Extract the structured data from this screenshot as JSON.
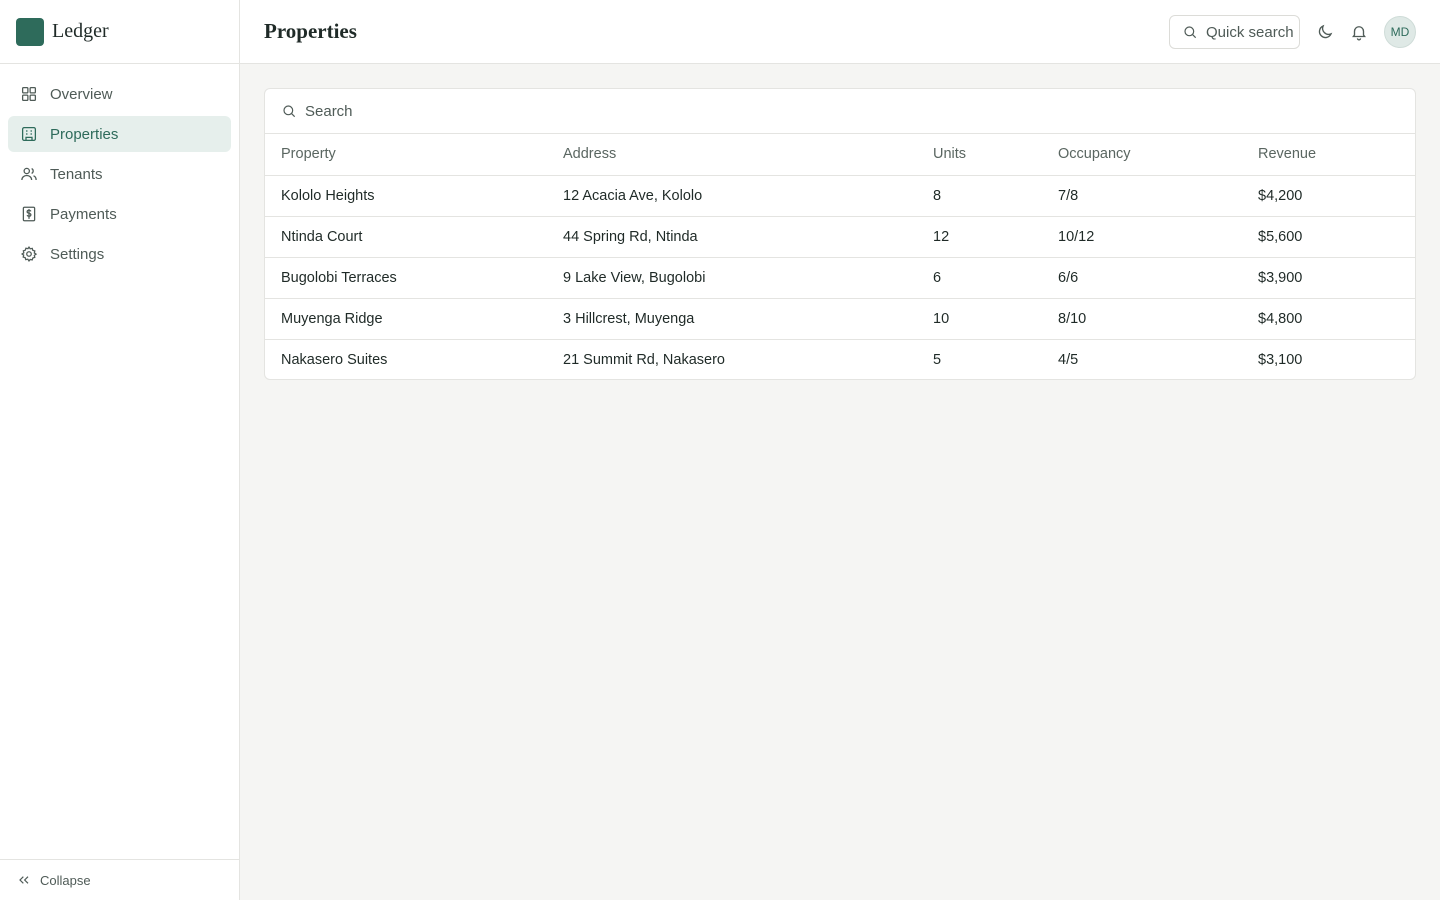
{
  "app": {
    "name": "Ledger",
    "brand_color": "#2e6b5b"
  },
  "sidebar": {
    "items": [
      {
        "label": "Overview",
        "icon": "grid-icon"
      },
      {
        "label": "Properties",
        "icon": "building-icon",
        "active": true
      },
      {
        "label": "Tenants",
        "icon": "users-icon"
      },
      {
        "label": "Payments",
        "icon": "receipt-dollar-icon"
      },
      {
        "label": "Settings",
        "icon": "gear-icon"
      }
    ],
    "collapse_label": "Collapse"
  },
  "header": {
    "title": "Properties",
    "quick_search_label": "Quick search",
    "avatar_initials": "MD"
  },
  "table": {
    "search_placeholder": "Search",
    "columns": [
      "Property",
      "Address",
      "Units",
      "Occupancy",
      "Revenue"
    ],
    "rows": [
      [
        "Kololo Heights",
        "12 Acacia Ave, Kololo",
        "8",
        "7/8",
        "$4,200"
      ],
      [
        "Ntinda Court",
        "44 Spring Rd, Ntinda",
        "12",
        "10/12",
        "$5,600"
      ],
      [
        "Bugolobi Terraces",
        "9 Lake View, Bugolobi",
        "6",
        "6/6",
        "$3,900"
      ],
      [
        "Muyenga Ridge",
        "3 Hillcrest, Muyenga",
        "10",
        "8/10",
        "$4,800"
      ],
      [
        "Nakasero Suites",
        "21 Summit Rd, Nakasero",
        "5",
        "4/5",
        "$3,100"
      ]
    ]
  }
}
